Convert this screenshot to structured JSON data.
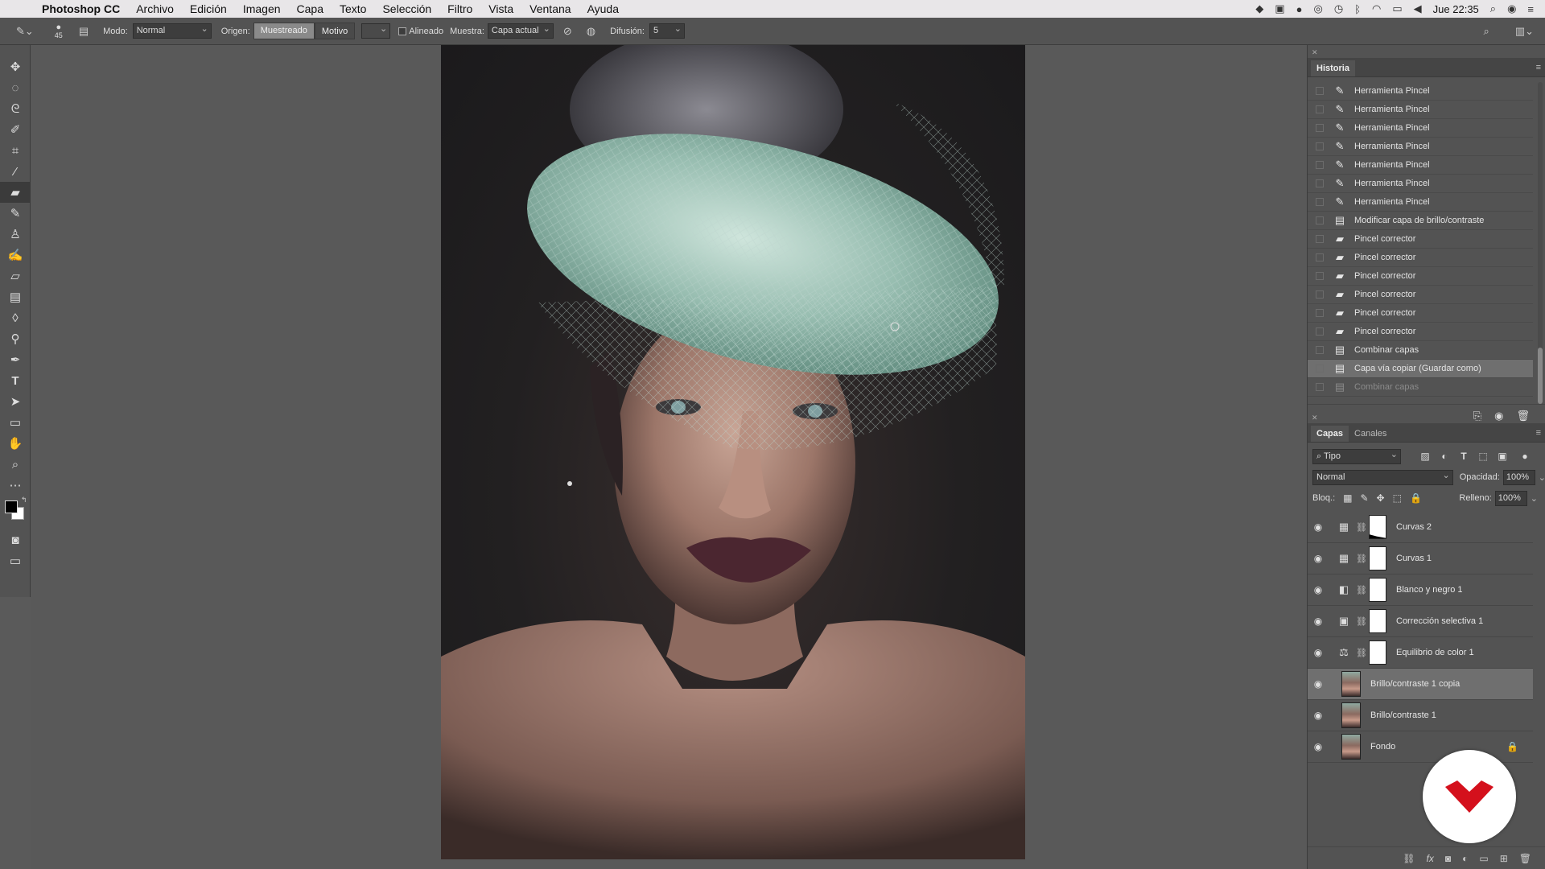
{
  "menubar": {
    "app": "Photoshop CC",
    "items": [
      "Archivo",
      "Edición",
      "Imagen",
      "Capa",
      "Texto",
      "Selección",
      "Filtro",
      "Vista",
      "Ventana",
      "Ayuda"
    ],
    "clock": "Jue 22:35"
  },
  "options_bar": {
    "brush_size": "45",
    "mode_label": "Modo:",
    "mode_value": "Normal",
    "source_label": "Origen:",
    "source_sampled": "Muestreado",
    "source_pattern": "Motivo",
    "aligned_label": "Alineado",
    "sample_label": "Muestra:",
    "sample_value": "Capa actual",
    "diffusion_label": "Difusión:",
    "diffusion_value": "5"
  },
  "history": {
    "tab": "Historia",
    "items": [
      {
        "icon": "brush-icon",
        "label": "Herramienta Pincel"
      },
      {
        "icon": "brush-icon",
        "label": "Herramienta Pincel"
      },
      {
        "icon": "brush-icon",
        "label": "Herramienta Pincel"
      },
      {
        "icon": "brush-icon",
        "label": "Herramienta Pincel"
      },
      {
        "icon": "brush-icon",
        "label": "Herramienta Pincel"
      },
      {
        "icon": "brush-icon",
        "label": "Herramienta Pincel"
      },
      {
        "icon": "brush-icon",
        "label": "Herramienta Pincel"
      },
      {
        "icon": "document-icon",
        "label": "Modificar capa de brillo/contraste"
      },
      {
        "icon": "healing-brush-icon",
        "label": "Pincel corrector"
      },
      {
        "icon": "healing-brush-icon",
        "label": "Pincel corrector"
      },
      {
        "icon": "healing-brush-icon",
        "label": "Pincel corrector"
      },
      {
        "icon": "healing-brush-icon",
        "label": "Pincel corrector"
      },
      {
        "icon": "healing-brush-icon",
        "label": "Pincel corrector"
      },
      {
        "icon": "healing-brush-icon",
        "label": "Pincel corrector"
      },
      {
        "icon": "document-icon",
        "label": "Combinar capas"
      },
      {
        "icon": "document-icon",
        "label": "Capa vía copiar (Guardar como)",
        "selected": true
      },
      {
        "icon": "document-icon",
        "label": "Combinar capas",
        "dimmed": true
      }
    ]
  },
  "layers": {
    "tab_layers": "Capas",
    "tab_channels": "Canales",
    "kind_filter": "Tipo",
    "blend_mode": "Normal",
    "opacity_label": "Opacidad:",
    "opacity_value": "100%",
    "lock_label": "Bloq.:",
    "fill_label": "Relleno:",
    "fill_value": "100%",
    "items": [
      {
        "name": "Curvas 2",
        "type": "adjustment",
        "icon": "curves-icon"
      },
      {
        "name": "Curvas 1",
        "type": "adjustment",
        "icon": "curves-icon"
      },
      {
        "name": "Blanco y negro 1",
        "type": "adjustment",
        "icon": "black-white-icon"
      },
      {
        "name": "Corrección selectiva 1",
        "type": "adjustment",
        "icon": "selective-color-icon"
      },
      {
        "name": "Equilibrio de color 1",
        "type": "adjustment",
        "icon": "color-balance-icon"
      },
      {
        "name": "Brillo/contraste 1 copia",
        "type": "pixel",
        "selected": true
      },
      {
        "name": "Brillo/contraste 1",
        "type": "pixel"
      },
      {
        "name": "Fondo",
        "type": "pixel",
        "locked": true
      }
    ]
  },
  "colors": {
    "accent_logo": "#d4101c",
    "panel_bg": "#535353",
    "selected_row": "#6f6f6f"
  }
}
